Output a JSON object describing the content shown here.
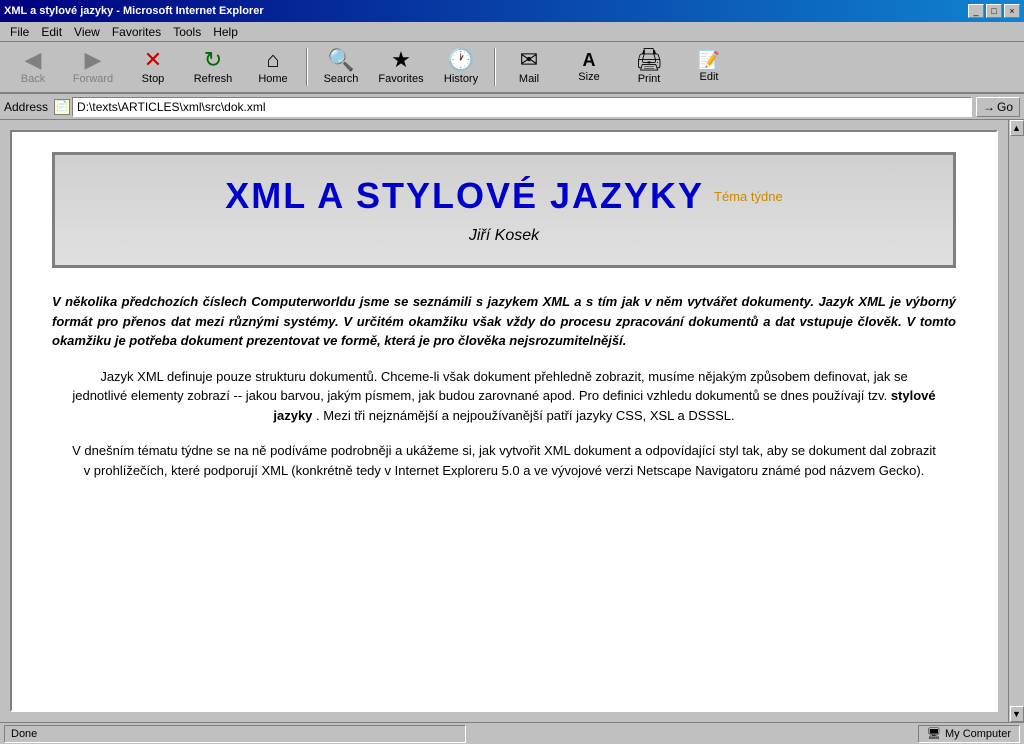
{
  "window": {
    "title": "XML a stylové jazyky - Microsoft Internet Explorer",
    "title_bar_buttons": [
      "_",
      "□",
      "×"
    ]
  },
  "menu": {
    "items": [
      "File",
      "Edit",
      "View",
      "Favorites",
      "Tools",
      "Help"
    ]
  },
  "toolbar": {
    "buttons": [
      {
        "id": "back",
        "label": "Back",
        "icon": "◀",
        "disabled": true
      },
      {
        "id": "forward",
        "label": "Forward",
        "icon": "▶",
        "disabled": true
      },
      {
        "id": "stop",
        "label": "Stop",
        "icon": "✕"
      },
      {
        "id": "refresh",
        "label": "Refresh",
        "icon": "↻"
      },
      {
        "id": "home",
        "label": "Home",
        "icon": "⌂"
      },
      {
        "id": "search",
        "label": "Search",
        "icon": "🔍"
      },
      {
        "id": "favorites",
        "label": "Favorites",
        "icon": "★"
      },
      {
        "id": "history",
        "label": "History",
        "icon": "🕐"
      },
      {
        "id": "mail",
        "label": "Mail",
        "icon": "✉"
      },
      {
        "id": "size",
        "label": "Size",
        "icon": "A"
      },
      {
        "id": "print",
        "label": "Print",
        "icon": "🖨"
      },
      {
        "id": "edit",
        "label": "Edit",
        "icon": "📝"
      }
    ]
  },
  "address_bar": {
    "label": "Address",
    "value": "D:\\texts\\ARTICLES\\xml\\src\\dok.xml",
    "go_label": "Go"
  },
  "document": {
    "main_title": "XML A STYLOVÉ JAZYKY",
    "subtitle": "Téma týdne",
    "author": "Jiří Kosek",
    "intro": "V několika předchozích číslech Computerworldu jsme se seznámili s jazykem XML a s tím jak v něm vytvářet dokumenty. Jazyk XML je výborný formát pro přenos dat mezi různými systémy. V určitém okamžiku však vždy do procesu zpracování dokumentů a dat vstupuje člověk. V tomto okamžiku je potřeba dokument prezentovat ve formě, která je pro člověka nejsrozumitelnější.",
    "para1": "Jazyk XML definuje pouze strukturu dokumentů. Chceme-li však dokument přehledně zobrazit, musíme nějakým způsobem definovat, jak se jednotlivé elementy zobrazí -- jakou barvou, jakým písmem, jak budou zarovnané apod. Pro definici vzhledu dokumentů se dnes používají tzv. stylové jazyky . Mezi tři nejznámější a nejpoužívanější patří jazyky CSS, XSL a DSSSL.",
    "para1_bold": "stylové jazyky",
    "para2": "V dnešním tématu týdne se na ně podíváme podrobněji a ukážeme si, jak vytvořit XML dokument a odpovídající styl tak, aby se dokument dal zobrazit v prohlížečích, které podporují XML (konkrétně tedy v Internet Exploreru 5.0 a ve vývojové verzi Netscape Navigatoru známé pod názvem Gecko)."
  },
  "status_bar": {
    "text": "Done",
    "zone": "My Computer"
  }
}
